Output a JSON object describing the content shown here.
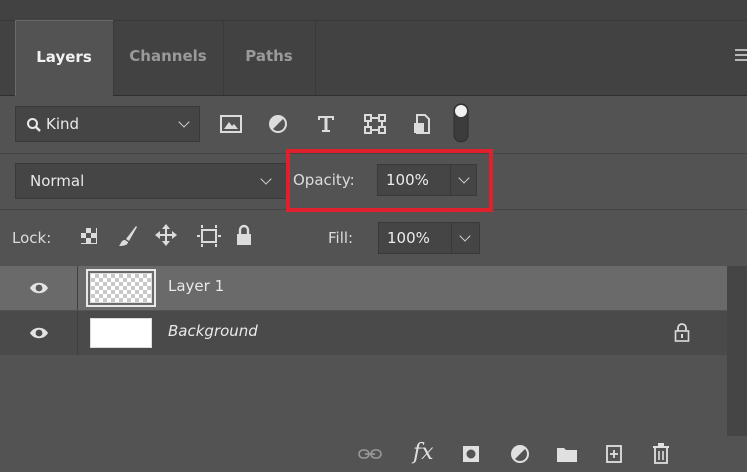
{
  "tabs": [
    {
      "label": "Layers",
      "active": true
    },
    {
      "label": "Channels",
      "active": false
    },
    {
      "label": "Paths",
      "active": false
    }
  ],
  "filter": {
    "kind_label": "Kind",
    "icons": [
      "image-filter-icon",
      "adjustment-filter-icon",
      "type-filter-icon",
      "shape-filter-icon",
      "smart-object-filter-icon",
      "filter-toggle-icon"
    ]
  },
  "blend": {
    "mode": "Normal",
    "opacity_label": "Opacity:",
    "opacity_value": "100%"
  },
  "lock": {
    "label": "Lock:",
    "fill_label": "Fill:",
    "fill_value": "100%"
  },
  "layers": [
    {
      "name": "Layer 1",
      "selected": true,
      "visible": true,
      "locked": false
    },
    {
      "name": "Background",
      "selected": false,
      "visible": true,
      "locked": true
    }
  ],
  "colors": {
    "panel_bg": "#535353",
    "selected_row": "#6a6a6a",
    "highlight": "#e0202d"
  }
}
